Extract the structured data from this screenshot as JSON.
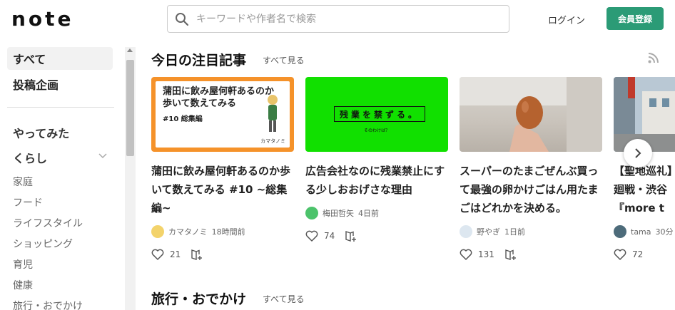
{
  "header": {
    "logo": "note",
    "search_placeholder": "キーワードや作者名で検索",
    "login": "ログイン",
    "signup": "会員登録"
  },
  "sidebar": {
    "top": [
      "すべて",
      "投稿企画"
    ],
    "categories": [
      "やってみた",
      "くらし"
    ],
    "subs": [
      "家庭",
      "フード",
      "ライフスタイル",
      "ショッピング",
      "育児",
      "健康",
      "旅行・おでかけ"
    ]
  },
  "main": {
    "section1_title": "今日の注目記事",
    "see_all": "すべて見る",
    "section2_title": "旅行・おでかけ",
    "cards": [
      {
        "thumb_title": "蒲田に飲み屋何軒あるのか\n歩いて数えてみる",
        "thumb_sub": "#10 総集編",
        "thumb_brand": "カマタノミ",
        "title": "蒲田に飲み屋何軒あるのか歩いて数えてみる #10 ~総集編~",
        "author": "カマタノミ",
        "time": "18時間前",
        "likes": "21",
        "accent": "#f5922a"
      },
      {
        "thumb_title": "残業を禁ずる。",
        "thumb_sub": "そのわけは？",
        "title": "広告会社なのに残業禁止にする少しおおげさな理由",
        "author": "梅田哲矢",
        "time": "4日前",
        "likes": "74",
        "accent": "#11e000"
      },
      {
        "title": "スーパーのたまごぜんぶ買って最強の卵かけごはん用たまごはどれかを決める。",
        "author": "野やぎ",
        "time": "1日前",
        "likes": "131"
      },
      {
        "title": "【聖地巡礼】\n廻戦・渋谷\n『more t",
        "author": "tama",
        "time": "30分",
        "likes": "72"
      }
    ]
  },
  "icons": {
    "search": "search-icon",
    "rss": "rss-icon",
    "like": "heart-icon",
    "magazine": "add-to-magazine-icon",
    "next": "chevron-right-icon"
  }
}
